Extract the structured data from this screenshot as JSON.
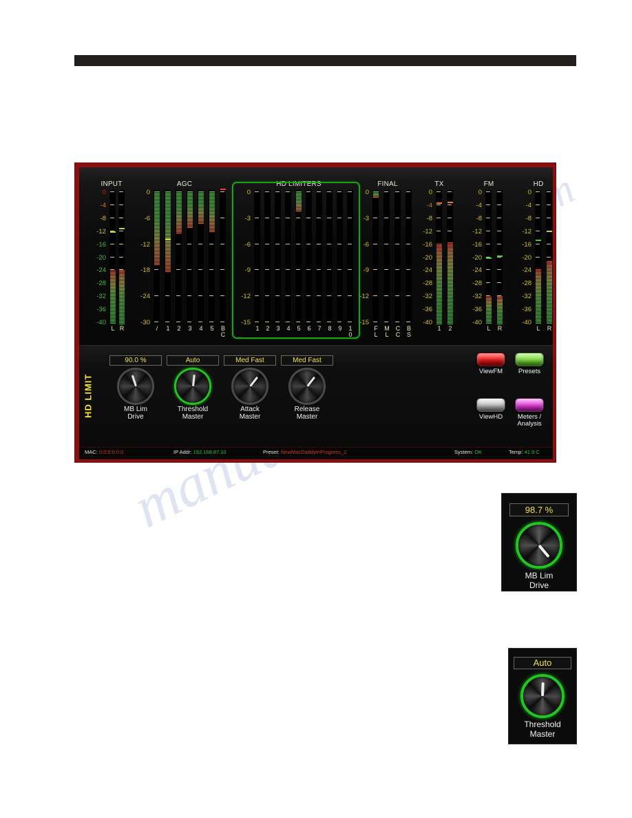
{
  "device": {
    "bezel_color": "#8b0f10",
    "screen_bg": "#0a0a0a",
    "highlight_color": "#18a318",
    "value_text_color": "#f0e24a"
  },
  "meters": {
    "groups": [
      {
        "title": "INPUT",
        "scale": [
          "0",
          "-4",
          "-8",
          "-12",
          "-16",
          "-20",
          "-24",
          "-28",
          "-32",
          "-36",
          "-40"
        ],
        "scale_colors": [
          "#c8281c",
          "#d8741c",
          "#cfc12a",
          "#cfc12a",
          "#3fbf3f",
          "#3fbf3f",
          "#3fbf3f",
          "#3fbf3f",
          "#3fbf3f",
          "#3fbf3f",
          "#3fbf3f"
        ],
        "scale_min": -40,
        "scale_max": 0,
        "channels": [
          {
            "label": "L",
            "value": -24.0,
            "peak": -12.8,
            "direction": "up"
          },
          {
            "label": "R",
            "value": -23.8,
            "peak": -11.6,
            "direction": "up"
          }
        ]
      },
      {
        "title": "AGC",
        "scale": [
          "0",
          "-6",
          "-12",
          "-18",
          "-24",
          "-30"
        ],
        "scale_colors": [
          "#cfc12a",
          "#cfc12a",
          "#cfc12a",
          "#cfc12a",
          "#cfc12a",
          "#cfc12a"
        ],
        "scale_min": -30,
        "scale_max": 0,
        "channels": [
          {
            "label": "/",
            "value": -16.5,
            "peak": null,
            "direction": "down"
          },
          {
            "label": "1",
            "value": -18.2,
            "peak": -11.3,
            "direction": "down"
          },
          {
            "label": "2",
            "value": -9.6,
            "peak": null,
            "direction": "down"
          },
          {
            "label": "3",
            "value": -8.2,
            "peak": null,
            "direction": "down"
          },
          {
            "label": "4",
            "value": -7.4,
            "peak": null,
            "direction": "down"
          },
          {
            "label": "5",
            "value": -9.2,
            "peak": null,
            "direction": "down"
          },
          {
            "label": "BC",
            "value": 0,
            "peak": 0,
            "direction": "down"
          }
        ]
      },
      {
        "title": "HD LIMITERS",
        "framed": true,
        "scale": [
          "0",
          "-3",
          "-6",
          "-9",
          "-12",
          "-15"
        ],
        "scale_colors": [
          "#cfc12a",
          "#cfc12a",
          "#cfc12a",
          "#cfc12a",
          "#cfc12a",
          "#cfc12a"
        ],
        "scale_min": -15,
        "scale_max": 0,
        "channels": [
          {
            "label": "1",
            "value": 0,
            "direction": "down"
          },
          {
            "label": "2",
            "value": 0,
            "direction": "down"
          },
          {
            "label": "3",
            "value": 0,
            "direction": "down"
          },
          {
            "label": "4",
            "value": 0,
            "direction": "down"
          },
          {
            "label": "5",
            "value": -2.3,
            "direction": "down"
          },
          {
            "label": "6",
            "value": 0,
            "direction": "down"
          },
          {
            "label": "7",
            "value": 0,
            "direction": "down"
          },
          {
            "label": "8",
            "value": 0,
            "direction": "down"
          },
          {
            "label": "9",
            "value": 0,
            "direction": "down"
          },
          {
            "label": "10",
            "value": 0,
            "direction": "down"
          }
        ]
      },
      {
        "title": "FINAL",
        "scale": [
          "0",
          "-3",
          "-6",
          "-9",
          "-12",
          "-15"
        ],
        "scale_colors": [
          "#cfc12a",
          "#cfc12a",
          "#cfc12a",
          "#cfc12a",
          "#cfc12a",
          "#cfc12a"
        ],
        "scale_min": -15,
        "scale_max": 0,
        "channels": [
          {
            "label": "FL",
            "value": -0.7,
            "direction": "down"
          },
          {
            "label": "ML",
            "value": 0,
            "direction": "down"
          },
          {
            "label": "CC",
            "value": 0,
            "direction": "down"
          },
          {
            "label": "BS",
            "value": 0,
            "direction": "down"
          }
        ]
      },
      {
        "title": "TX",
        "scale": [
          "0",
          "-4",
          "-8",
          "-12",
          "-16",
          "-20",
          "-24",
          "-28",
          "-32",
          "-36",
          "-40"
        ],
        "scale_colors": [
          "#cfc12a",
          "#d8741c",
          "#cfc12a",
          "#cfc12a",
          "#cfc12a",
          "#cfc12a",
          "#cfc12a",
          "#cfc12a",
          "#cfc12a",
          "#cfc12a",
          "#cfc12a"
        ],
        "scale_min": -40,
        "scale_max": 0,
        "channels": [
          {
            "label": "1",
            "value": -16.0,
            "peak": -4.2,
            "direction": "up"
          },
          {
            "label": "2",
            "value": -15.6,
            "peak": -3.9,
            "direction": "up"
          }
        ]
      },
      {
        "title": "FM",
        "scale": [
          "0",
          "-4",
          "-8",
          "-12",
          "-16",
          "-20",
          "-24",
          "-28",
          "-32",
          "-36",
          "-40"
        ],
        "scale_colors": [
          "#cfc12a",
          "#cfc12a",
          "#cfc12a",
          "#cfc12a",
          "#cfc12a",
          "#cfc12a",
          "#cfc12a",
          "#cfc12a",
          "#cfc12a",
          "#cfc12a",
          "#cfc12a"
        ],
        "scale_min": -40,
        "scale_max": 0,
        "channels": [
          {
            "label": "L",
            "value": -31.8,
            "peak": -20.6,
            "direction": "up"
          },
          {
            "label": "R",
            "value": -31.5,
            "peak": -19.8,
            "direction": "up"
          }
        ]
      },
      {
        "title": "HD",
        "scale": [
          "0",
          "-4",
          "-8",
          "-12",
          "-16",
          "-20",
          "-24",
          "-28",
          "-32",
          "-36",
          "-40"
        ],
        "scale_colors": [
          "#cfc12a",
          "#cfc12a",
          "#cfc12a",
          "#cfc12a",
          "#cfc12a",
          "#cfc12a",
          "#cfc12a",
          "#cfc12a",
          "#cfc12a",
          "#cfc12a",
          "#cfc12a"
        ],
        "scale_min": -40,
        "scale_max": 0,
        "channels": [
          {
            "label": "L",
            "value": -23.6,
            "peak": -15.2,
            "direction": "up"
          },
          {
            "label": "R",
            "value": -21.2,
            "peak": -12.6,
            "direction": "up"
          }
        ]
      }
    ]
  },
  "control_strip": {
    "section_label": "HD LIMIT",
    "knobs": [
      {
        "value": "90.0 %",
        "label_line1": "MB Lim",
        "label_line2": "Drive",
        "active": false,
        "angle": -18
      },
      {
        "value": "Auto",
        "label_line1": "Threshold",
        "label_line2": "Master",
        "active": true,
        "angle": 6
      },
      {
        "value": "Med Fast",
        "label_line1": "Attack",
        "label_line2": "Master",
        "active": false,
        "angle": 38
      },
      {
        "value": "Med Fast",
        "label_line1": "Release",
        "label_line2": "Master",
        "active": false,
        "angle": 38
      }
    ],
    "buttons": [
      {
        "label": "ViewFM",
        "color": "red"
      },
      {
        "label": "Presets",
        "color": "green"
      },
      {
        "label": "ViewHD",
        "color": "silver"
      },
      {
        "label": "Meters /\nAnalysis",
        "color": "magenta"
      }
    ]
  },
  "status_bar": {
    "mac_key": "MAC:",
    "mac_value": "0:0:0:0:0:0",
    "ip_key": "IP Addr:",
    "ip_value": "192.168.87.10",
    "preset_key": "Preset:",
    "preset_value": "NewMacDaddyInProgress_2",
    "system_key": "System:",
    "system_value": "OK",
    "temp_key": "Temp:",
    "temp_value": "41.9 C"
  },
  "insets": [
    {
      "value": "98.7 %",
      "label_line1": "MB Lim",
      "label_line2": "Drive",
      "active": true,
      "angle": 140
    },
    {
      "value": "Auto",
      "label_line1": "Threshold",
      "label_line2": "Master",
      "active": true,
      "angle": 2
    }
  ],
  "watermark": {
    "text": "manualshive.com"
  }
}
